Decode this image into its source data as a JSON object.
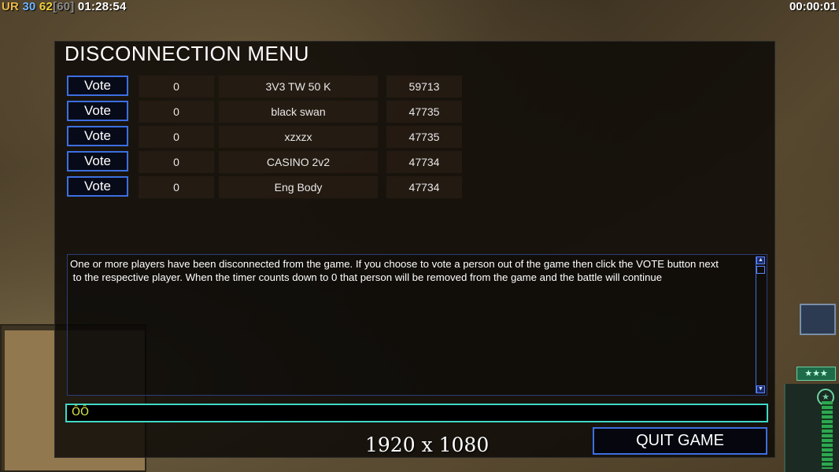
{
  "hud": {
    "ur_label": "UR",
    "value_30": "30",
    "value_62": "62",
    "value_60": "[60]",
    "game_time": "01:28:54",
    "timer": "00:00:01"
  },
  "dialog": {
    "title": "DISCONNECTION MENU",
    "players": [
      {
        "vote_label": "Vote",
        "count": "0",
        "name": "3V3 TW 50 K",
        "ping": "59713"
      },
      {
        "vote_label": "Vote",
        "count": "0",
        "name": "black swan",
        "ping": "47735"
      },
      {
        "vote_label": "Vote",
        "count": "0",
        "name": "xzxzx",
        "ping": "47735"
      },
      {
        "vote_label": "Vote",
        "count": "0",
        "name": "CASINO 2v2",
        "ping": "47734"
      },
      {
        "vote_label": "Vote",
        "count": "0",
        "name": "Eng Body",
        "ping": "47734"
      }
    ],
    "message_line1": "One or more players have been disconnected from the game. If you choose to vote a person out of the game then click the VOTE button next",
    "message_line2": " to the respective player. When the timer counts down to 0 that person will be removed from the game and the battle will continue",
    "chat_value": "ÔÔ",
    "quit_label": "QUIT GAME"
  },
  "overlay": {
    "resolution": "1920 x 1080"
  },
  "side": {
    "stars": "★★★",
    "badge": "★"
  }
}
